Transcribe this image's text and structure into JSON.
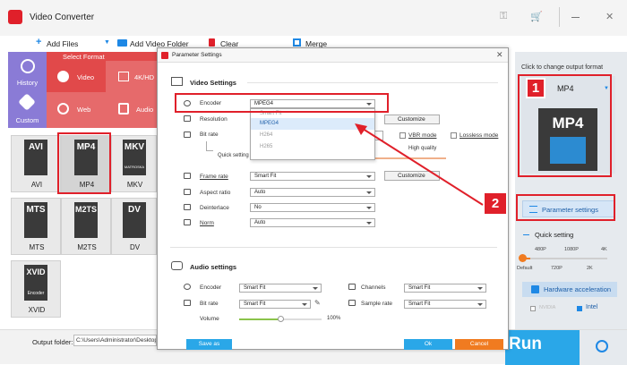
{
  "app": {
    "title": "Video Converter"
  },
  "toolbar": {
    "add_files": "Add Files",
    "add_video_folder": "Add Video Folder",
    "clear": "Clear",
    "merge": "Merge"
  },
  "format_header": "Select Format",
  "categories": [
    {
      "label": "History"
    },
    {
      "label": "Video"
    },
    {
      "label": "4K/HD"
    },
    {
      "label": "Custom"
    },
    {
      "label": "Web"
    },
    {
      "label": "Audio"
    }
  ],
  "formats": [
    {
      "card": "AVI",
      "label": "AVI"
    },
    {
      "card": "MP4",
      "label": "MP4"
    },
    {
      "card": "MKV",
      "label": "MKV"
    },
    {
      "card": "MTS",
      "label": "MTS"
    },
    {
      "card": "M2TS",
      "label": "M2TS"
    },
    {
      "card": "DV",
      "label": "DV"
    },
    {
      "card": "XVID",
      "label": "XVID"
    }
  ],
  "mkv_sub": "MATROSKA",
  "xvid_sub": "Encoder",
  "dialog": {
    "title": "Parameter Settings",
    "video_header": "Video Settings",
    "encoder_label": "Encoder",
    "encoder_value": "MPEG4",
    "resolution_label": "Resolution",
    "bitrate_label": "Bit rate",
    "customize": "Customize",
    "vbr_mode": "VBR mode",
    "lossless_mode": "Lossless mode",
    "quick_setting": "Quick setting",
    "high_quality": "High quality",
    "framerate_label": "Frame rate",
    "framerate_value": "Smart Fit",
    "aspect_label": "Aspect ratio",
    "aspect_value": "Auto",
    "deinterlace_label": "Deinterlace",
    "deinterlace_value": "No",
    "norm_label": "Norm",
    "norm_value": "Auto",
    "dropdown": [
      "Smart Fit",
      "MPEG4",
      "H264",
      "H265"
    ],
    "audio_header": "Audio settings",
    "a_encoder_label": "Encoder",
    "a_encoder_value": "Smart Fit",
    "a_bitrate_label": "Bit rate",
    "a_bitrate_value": "Smart Fit",
    "channels_label": "Channels",
    "channels_value": "Smart Fit",
    "sample_label": "Sample rate",
    "sample_value": "Smart Fit",
    "volume_label": "Volume",
    "volume_value": "100%",
    "save_as": "Save as",
    "ok": "Ok",
    "cancel": "Cancel"
  },
  "right": {
    "hint": "Click to change output format",
    "format": "MP4",
    "card": "MP4",
    "param_btn": "Parameter settings",
    "quick": "Quick setting",
    "ticks_top": [
      "480P",
      "1080P",
      "4K"
    ],
    "ticks_bottom": [
      "Default",
      "720P",
      "2K"
    ],
    "hw": "Hardware acceleration",
    "nvidia": "NVIDIA",
    "intel": "Intel"
  },
  "bottom": {
    "folder_label": "Output folder:",
    "folder_value": "C:\\Users\\Administrator\\Desktop",
    "run": "Run"
  },
  "badges": {
    "one": "1",
    "two": "2"
  },
  "colors": {
    "accent": "#1e88e5",
    "red": "#e0202a",
    "run": "#2aa7e8",
    "cancel": "#f07b20",
    "category": "#e1494a"
  }
}
